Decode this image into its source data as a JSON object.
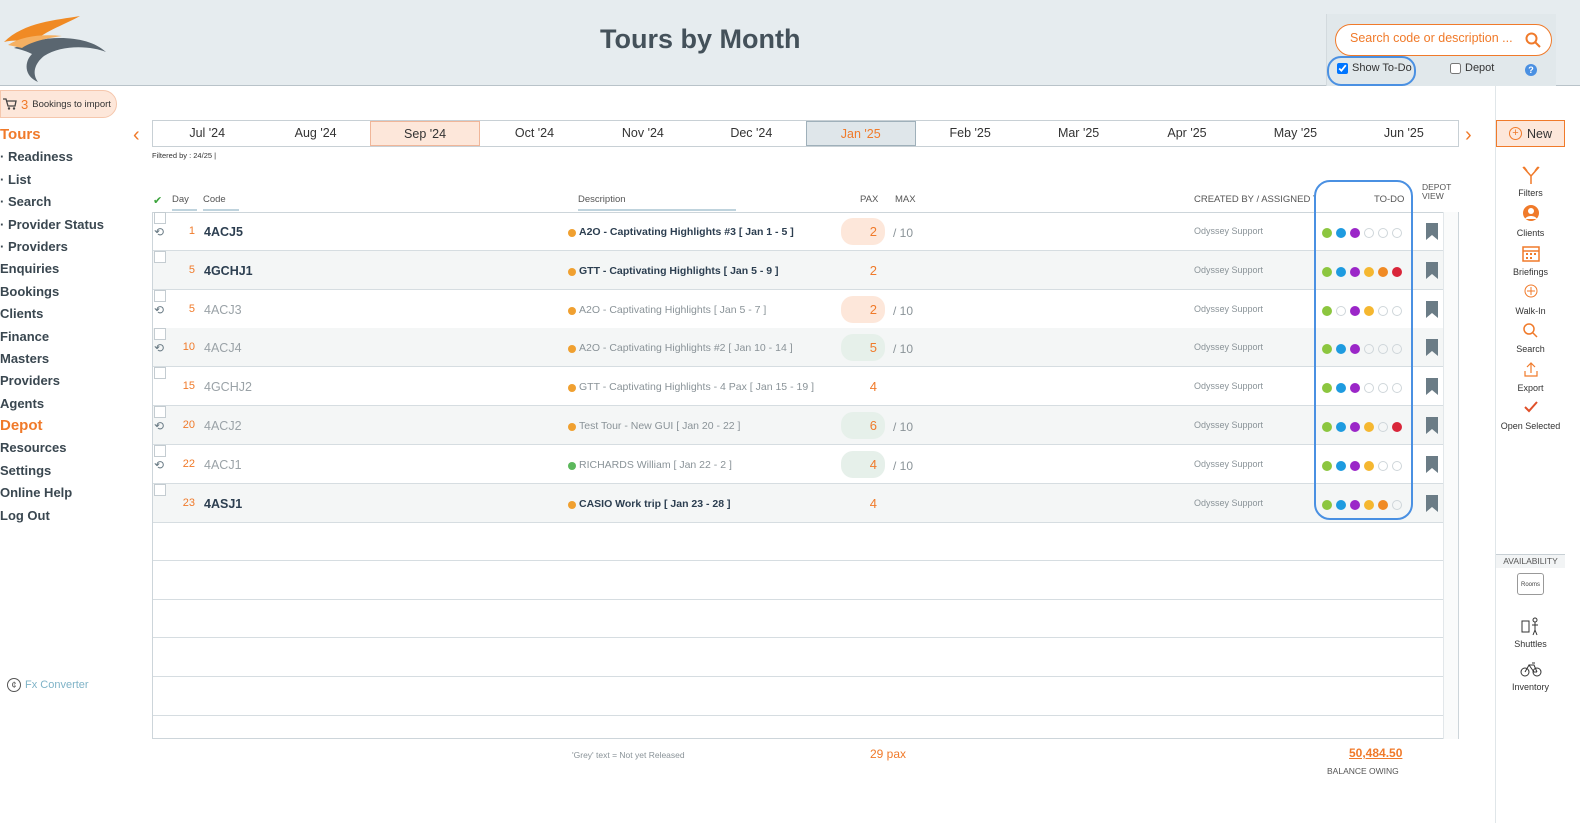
{
  "header": {
    "title": "Tours by Month",
    "search_placeholder": "Search code or description ...",
    "show_todo_label": "Show To-Do",
    "show_todo_checked": true,
    "depot_label": "Depot",
    "depot_checked": false,
    "help_icon": "?"
  },
  "imports": {
    "count": "3",
    "label": "Bookings to import",
    "icon": "cart-icon"
  },
  "nav": {
    "items": [
      {
        "label": "Tours",
        "section": true
      },
      {
        "label": "· Readiness"
      },
      {
        "label": "· List"
      },
      {
        "label": "· Search"
      },
      {
        "label": "· Provider Status"
      },
      {
        "label": "· Providers"
      },
      {
        "label": "Enquiries"
      },
      {
        "label": "Bookings"
      },
      {
        "label": "Clients"
      },
      {
        "label": "Finance"
      },
      {
        "label": "Masters"
      },
      {
        "label": "Providers"
      },
      {
        "label": "Agents"
      },
      {
        "label": "Depot",
        "section": true
      },
      {
        "label": "Resources"
      },
      {
        "label": "Settings"
      },
      {
        "label": "Online Help"
      },
      {
        "label": "Log Out"
      }
    ],
    "fx_label": "Fx Converter"
  },
  "months": {
    "items": [
      "Jul '24",
      "Aug '24",
      "Sep '24",
      "Oct '24",
      "Nov '24",
      "Dec '24",
      "Jan '25",
      "Feb '25",
      "Mar '25",
      "Apr '25",
      "May '25",
      "Jun '25"
    ],
    "selected": "Sep '24",
    "current": "Jan '25",
    "prev_arrow": "‹",
    "next_arrow": "›"
  },
  "filtered_text": "Filtered by : 24/25 |",
  "table": {
    "headers": {
      "check": "✔",
      "day": "Day",
      "code": "Code",
      "description": "Description",
      "pax": "PAX",
      "max": "MAX",
      "created": "CREATED BY / ASSIGNED TO",
      "todo": "TO-DO",
      "depot_view": "DEPOT VIEW"
    },
    "todo_colors": [
      "#8cc63f",
      "#1e9be0",
      "#9b27c8",
      "#f5b730",
      "#f08a24",
      "#d9263a"
    ],
    "rows": [
      {
        "day": "1",
        "code": "4ACJ5",
        "released": true,
        "history": true,
        "dot": "#f0a030",
        "desc": "A2O - Captivating Highlights #3   [ Jan 1 - 5 ]",
        "pax": "2",
        "pax_style": "o",
        "max": "/ 10",
        "owner": "Odyssey Support",
        "todos": [
          1,
          1,
          1,
          0,
          0,
          0
        ]
      },
      {
        "day": "5",
        "code": "4GCHJ1",
        "released": true,
        "history": false,
        "dot": "#f0a030",
        "desc": "GTT - Captivating Highlights   [ Jan 5 - 9 ]",
        "pax": "2",
        "pax_style": "",
        "max": "",
        "owner": "Odyssey Support",
        "todos": [
          1,
          1,
          1,
          1,
          1,
          1
        ]
      },
      {
        "day": "5",
        "code": "4ACJ3",
        "released": false,
        "history": true,
        "dot": "#f0a030",
        "desc": "A2O - Captivating Highlights   [ Jan 5 - 7 ]",
        "pax": "2",
        "pax_style": "o",
        "max": "/ 10",
        "owner": "Odyssey Support",
        "todos": [
          1,
          0,
          1,
          1,
          0,
          0
        ]
      },
      {
        "day": "10",
        "code": "4ACJ4",
        "released": false,
        "history": true,
        "dot": "#f0a030",
        "desc": "A2O - Captivating Highlights #2   [ Jan 10 - 14 ]",
        "pax": "5",
        "pax_style": "g",
        "max": "/ 10",
        "owner": "Odyssey Support",
        "todos": [
          1,
          1,
          1,
          0,
          0,
          0
        ]
      },
      {
        "day": "15",
        "code": "4GCHJ2",
        "released": false,
        "history": false,
        "dot": "#f0a030",
        "desc": "GTT - Captivating Highlights - 4 Pax   [ Jan 15 - 19 ]",
        "pax": "4",
        "pax_style": "",
        "max": "",
        "owner": "Odyssey Support",
        "todos": [
          1,
          1,
          1,
          0,
          0,
          0
        ]
      },
      {
        "day": "20",
        "code": "4ACJ2",
        "released": false,
        "history": true,
        "dot": "#f0a030",
        "desc": "Test Tour - New GUI   [ Jan 20 - 22 ]",
        "pax": "6",
        "pax_style": "g",
        "max": "/ 10",
        "owner": "Odyssey Support",
        "todos": [
          1,
          1,
          1,
          1,
          0,
          1
        ]
      },
      {
        "day": "22",
        "code": "4ACJ1",
        "released": false,
        "history": true,
        "dot": "#5cb85c",
        "desc": "RICHARDS William   [ Jan 22 - 2 ]",
        "pax": "4",
        "pax_style": "g",
        "max": "/ 10",
        "owner": "Odyssey Support",
        "todos": [
          1,
          1,
          1,
          1,
          0,
          0
        ]
      },
      {
        "day": "23",
        "code": "4ASJ1",
        "released": true,
        "history": false,
        "dot": "#f0a030",
        "desc": "CASIO Work trip   [ Jan 23 - 28 ]",
        "pax": "4",
        "pax_style": "",
        "max": "",
        "owner": "Odyssey Support",
        "todos": [
          1,
          1,
          1,
          1,
          1,
          0
        ]
      }
    ]
  },
  "footer": {
    "note": "'Grey' text = Not yet Released",
    "total_pax": "29 pax",
    "balance": "50,484.50",
    "balance_label": "BALANCE OWING"
  },
  "sidebar_right": {
    "new_label": "New",
    "tools": [
      {
        "label": "Filters",
        "icon": "filters-icon"
      },
      {
        "label": "Clients",
        "icon": "clients-icon"
      },
      {
        "label": "Briefings",
        "icon": "calendar-icon"
      },
      {
        "label": "Walk-In",
        "icon": "walk-in-icon"
      },
      {
        "label": "Search",
        "icon": "search-icon"
      },
      {
        "label": "Export",
        "icon": "export-icon"
      },
      {
        "label": "Open Selected",
        "icon": "check-icon"
      }
    ],
    "availability_label": "AVAILABILITY",
    "rooms_label": "Rooms",
    "shuttles_label": "Shuttles",
    "inventory_label": "Inventory"
  }
}
